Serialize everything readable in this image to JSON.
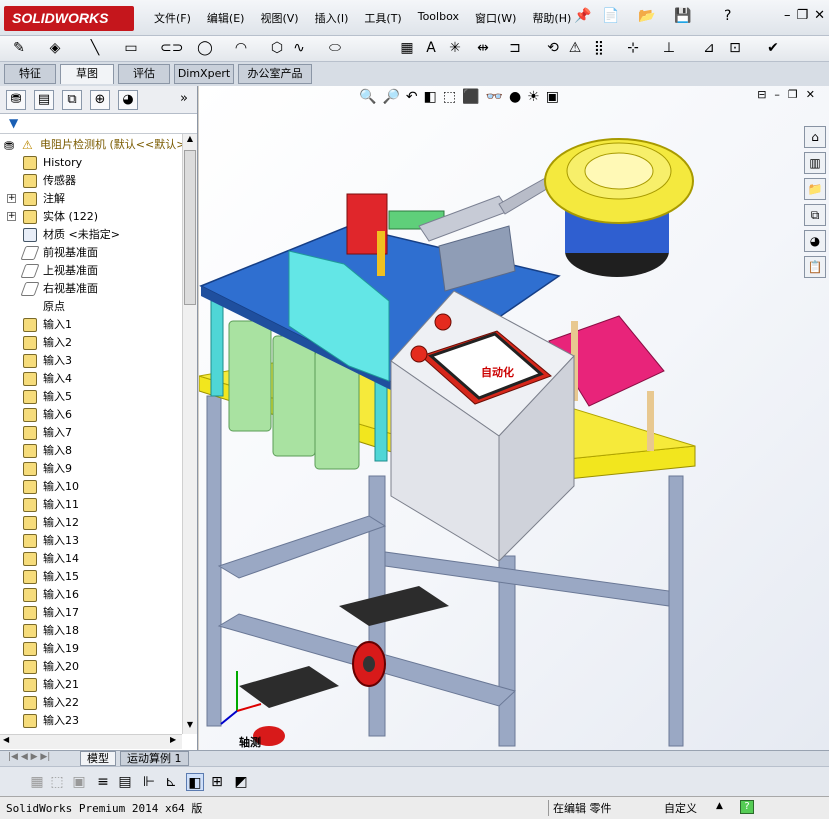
{
  "app": {
    "logo": "SOLIDWORKS"
  },
  "menu": [
    "文件(F)",
    "编辑(E)",
    "视图(V)",
    "插入(I)",
    "工具(T)",
    "Toolbox",
    "窗口(W)",
    "帮助(H)"
  ],
  "tabs": [
    "特征",
    "草图",
    "评估",
    "DimXpert",
    "办公室产品"
  ],
  "active_tab": "草图",
  "tree": {
    "root": "电阻片检测机  (默认<<默认>",
    "items": [
      "History",
      "传感器",
      "注解",
      "实体 (122)",
      "材质 <未指定>",
      "前视基准面",
      "上视基准面",
      "右视基准面",
      "原点",
      "输入1",
      "输入2",
      "输入3",
      "输入4",
      "输入5",
      "输入6",
      "输入7",
      "输入8",
      "输入9",
      "输入10",
      "输入11",
      "输入12",
      "输入13",
      "输入14",
      "输入15",
      "输入16",
      "输入17",
      "输入18",
      "输入19",
      "输入20",
      "输入21",
      "输入22",
      "输入23"
    ]
  },
  "viewport": {
    "hmi_text": "自动化",
    "triad_label": "轴测"
  },
  "bottom_tabs": [
    "模型",
    "运动算例 1"
  ],
  "status": {
    "product": "SolidWorks Premium 2014 x64 版",
    "mode": "在编辑 零件",
    "units": "自定义"
  },
  "colors": {
    "brand": "#c5161c",
    "yellow": "#f2e61e",
    "blue": "#2f6fd0",
    "magenta": "#e8247a"
  }
}
